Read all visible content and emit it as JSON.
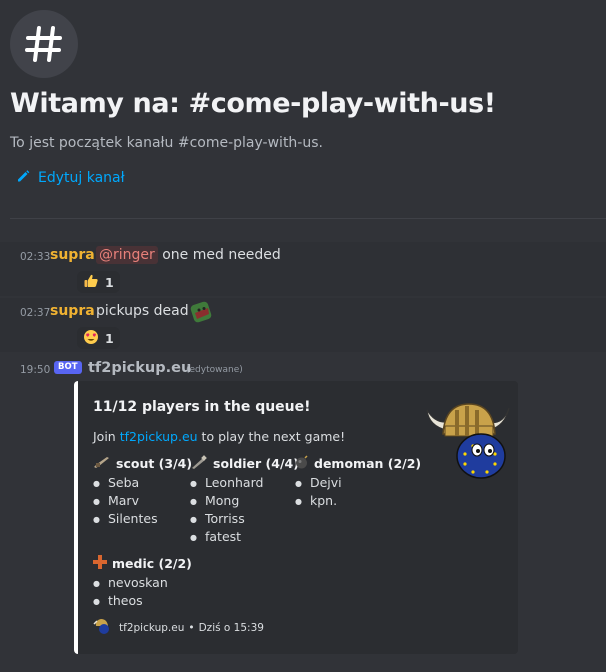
{
  "header": {
    "icon": "hash-icon",
    "title": "Witamy na: #come-play-with-us!",
    "subtitle": "To jest początek kanału #come-play-with-us.",
    "edit_label": "Edytuj kanał"
  },
  "messages": [
    {
      "time": "02:33",
      "author": "supra",
      "mention": "@ringer",
      "text": "one med needed",
      "reaction": {
        "emoji": "thumbs-up",
        "count": "1"
      }
    },
    {
      "time": "02:37",
      "author": "supra",
      "text": "pickups dead",
      "inline_emoji": "zombie-emoji",
      "reaction": {
        "emoji": "heart-eyes",
        "count": "1"
      }
    }
  ],
  "bot_message": {
    "time": "19:50",
    "badge": "BOT",
    "author": "tf2pickup.eu",
    "edited": "(edytowane)",
    "embed": {
      "title": "11/12 players in the queue!",
      "desc_prefix": "Join",
      "desc_link": "tf2pickup.eu",
      "desc_suffix": "to play the next game!",
      "fields": [
        {
          "name": "scout (3/4)",
          "icon": "scattergun-icon",
          "players": [
            "Seba",
            "Marv",
            "Silentes"
          ]
        },
        {
          "name": "soldier (4/4)",
          "icon": "rocket-launcher-icon",
          "players": [
            "Leonhard",
            "Mong",
            "Torriss",
            "fatest"
          ]
        },
        {
          "name": "demoman (2/2)",
          "icon": "bomb-icon",
          "players": [
            "Dejvi",
            "kpn."
          ]
        },
        {
          "name": "medic (2/2)",
          "icon": "medic-cross-icon",
          "players": [
            "nevoskan",
            "theos"
          ]
        }
      ],
      "footer_text": "tf2pickup.eu",
      "footer_sep": "•",
      "footer_time": "Dziś o 15:39"
    }
  },
  "colors": {
    "background": "#313338",
    "author": "#f0b232",
    "link": "#00a8fc",
    "bot_badge": "#5865f2"
  }
}
